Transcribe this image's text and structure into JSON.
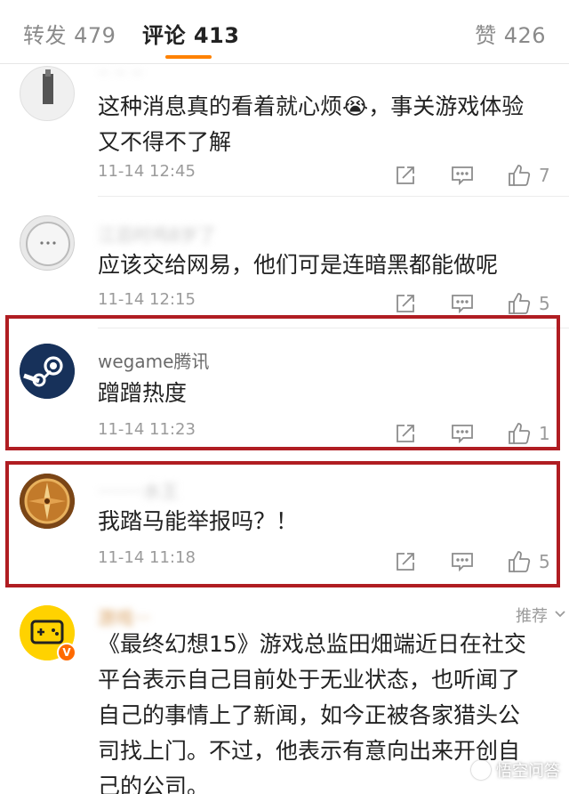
{
  "tabs": {
    "repost": "转发 479",
    "comments": "评论 413",
    "likes": "赞 426"
  },
  "comments": [
    {
      "username": "·· ·· ··",
      "text_lines": [
        "这种消息真的看着就心烦😭，事关游戏体验",
        "又不得不了解"
      ],
      "time": "11-14 12:45",
      "likes": "7"
    },
    {
      "username": "江忌时鸡8岁了",
      "text_lines": [
        "应该交给网易，他们可是连暗黑都能做呢"
      ],
      "time": "11-14 12:15",
      "likes": "5"
    },
    {
      "username": "wegame腾讯",
      "text_lines": [
        "蹭蹭热度"
      ],
      "time": "11-14 11:23",
      "likes": "1"
    },
    {
      "username": "········水王",
      "text_lines": [
        "我踏马能举报吗？！"
      ],
      "time": "11-14 11:18",
      "likes": "5"
    },
    {
      "username": "游戏···",
      "recommend": "推荐",
      "text_lines": [
        "《最终幻想15》游戏总监田畑端近日在社交",
        "平台表示自己目前处于无业状态，也听闻了",
        "自己的事情上了新闻，如今正被各家猎头公",
        "司找上门。不过，他表示有意向出来开创自",
        "己的公司。"
      ]
    }
  ],
  "watermark": "悟空问答",
  "colors": {
    "accent": "#ff8200",
    "highlight_border": "#b01d22",
    "muted": "#9b9b9b"
  }
}
